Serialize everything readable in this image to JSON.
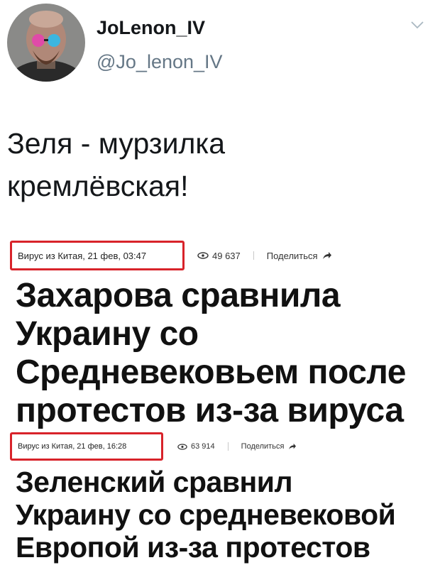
{
  "tweet": {
    "display_name": "JoLenon_IV",
    "handle": "@Jo_lenon_IV",
    "text_lines": [
      "Зеля - мурзилка",
      "кремлёвская!"
    ]
  },
  "articles": [
    {
      "date": "Вирус из Китая, 21 фев, 03:47",
      "views": "49 637",
      "share_label": "Поделиться",
      "headline_lines": [
        "Захарова сравнила",
        "Украину со",
        "Средневековьем после",
        "протестов из-за вируса"
      ]
    },
    {
      "date": "Вирус из Китая, 21 фев, 16:28",
      "views": "63 914",
      "share_label": "Поделиться",
      "headline_lines": [
        "Зеленский сравнил",
        "Украину со средневековой",
        "Европой из-за протестов"
      ]
    }
  ],
  "icons": {
    "chevron": "chevron-down-icon",
    "views": "eye-icon",
    "share": "share-arrow-icon"
  },
  "colors": {
    "highlight_box": "#d8232a",
    "handle_text": "#657786"
  }
}
